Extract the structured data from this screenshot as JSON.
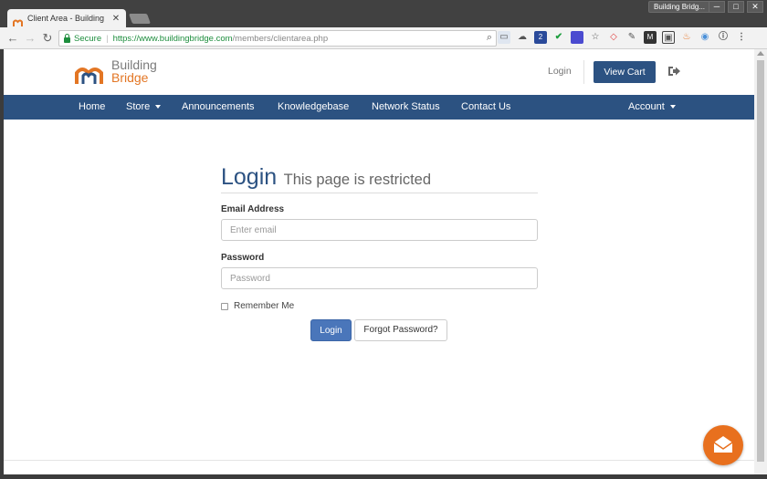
{
  "browser": {
    "tab_title": "Client Area - Building Bridge",
    "tab_close": "✕",
    "window_label": "Building Bridg...",
    "window_controls": [
      "─",
      "□",
      "✕"
    ],
    "secure_label": "Secure",
    "url_host": "https://www.buildingbridge.com",
    "url_path": "/members/clientarea.php",
    "extension_badge": "2"
  },
  "header": {
    "logo_line1": "Building",
    "logo_line2": "Bridge",
    "login_link": "Login",
    "view_cart": "View Cart"
  },
  "nav": {
    "items": [
      {
        "label": "Home",
        "dropdown": false
      },
      {
        "label": "Store",
        "dropdown": true
      },
      {
        "label": "Announcements",
        "dropdown": false
      },
      {
        "label": "Knowledgebase",
        "dropdown": false
      },
      {
        "label": "Network Status",
        "dropdown": false
      },
      {
        "label": "Contact Us",
        "dropdown": false
      }
    ],
    "account": "Account"
  },
  "login": {
    "title": "Login",
    "subtitle": "This page is restricted",
    "email_label": "Email Address",
    "email_placeholder": "Enter email",
    "password_label": "Password",
    "password_placeholder": "Password",
    "remember_label": "Remember Me",
    "submit_label": "Login",
    "forgot_label": "Forgot Password?"
  },
  "colors": {
    "brand_blue": "#2c5282",
    "brand_orange": "#e37624",
    "button_blue": "#4a76ba"
  }
}
